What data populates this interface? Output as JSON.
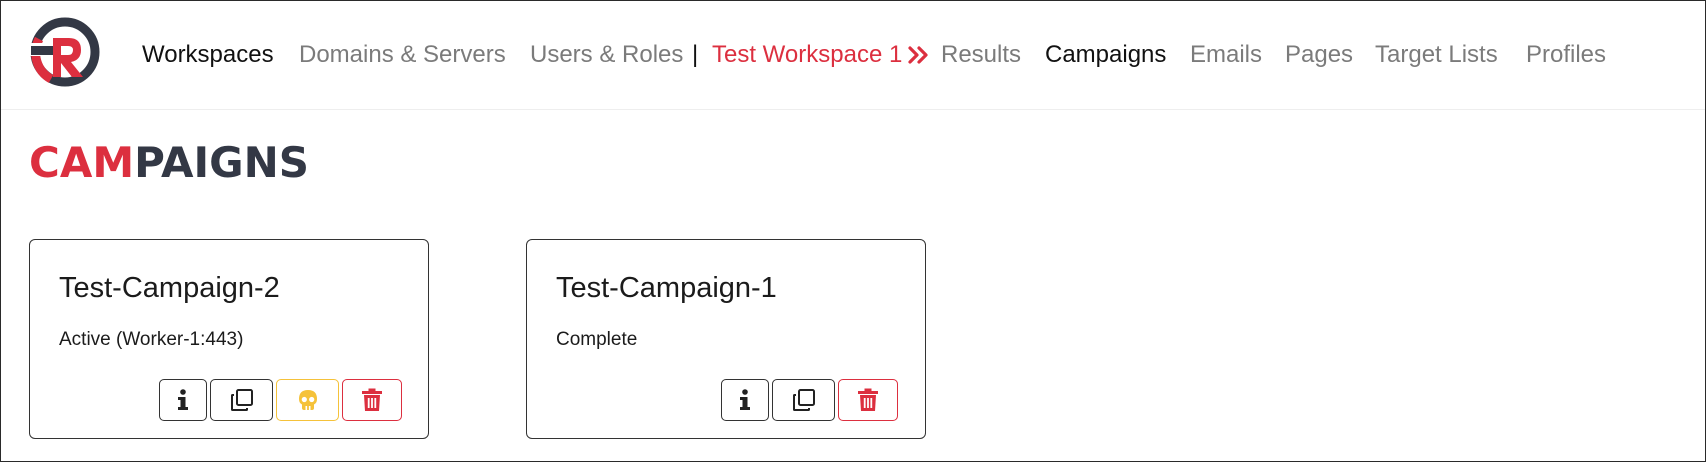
{
  "nav": {
    "workspaces": "Workspaces",
    "domains_servers": "Domains & Servers",
    "users_roles": "Users & Roles",
    "separator": "|",
    "workspace_name": "Test Workspace 1",
    "results": "Results",
    "campaigns": "Campaigns",
    "emails": "Emails",
    "pages": "Pages",
    "target_lists": "Target Lists",
    "profiles": "Profiles"
  },
  "page": {
    "title_accent": "CAM",
    "title_rest": "PAIGNS"
  },
  "campaigns": [
    {
      "name": "Test-Campaign-2",
      "status": "Active (Worker-1:443)",
      "actions": [
        "info-icon",
        "copy-icon",
        "skull-icon",
        "trash-icon"
      ]
    },
    {
      "name": "Test-Campaign-1",
      "status": "Complete",
      "actions": [
        "info-icon",
        "copy-icon",
        "trash-icon"
      ]
    }
  ],
  "colors": {
    "brand_red": "#dc2f3f",
    "dark": "#333845",
    "muted_nav": "#7b7b7b",
    "warning": "#f5c23a"
  }
}
